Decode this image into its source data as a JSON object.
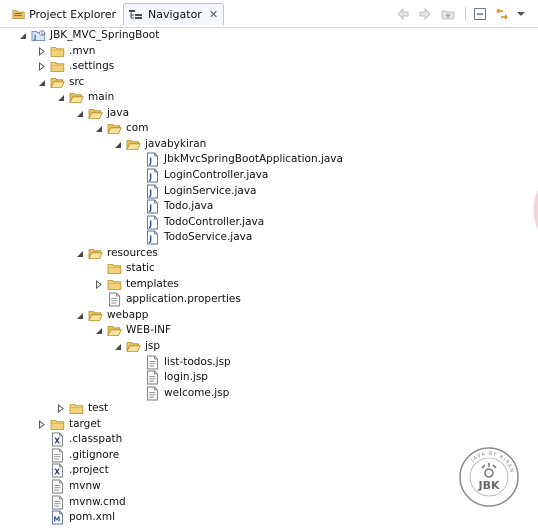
{
  "tabs": {
    "project_explorer": "Project Explorer",
    "navigator": "Navigator"
  },
  "tree": [
    {
      "name": "project-jbk-mvc-springboot",
      "label": "JBK_MVC_SpringBoot",
      "icon": "project",
      "depth": 0,
      "arrow": "expanded"
    },
    {
      "name": "folder-mvn",
      "label": ".mvn",
      "icon": "folder",
      "depth": 1,
      "arrow": "collapsed"
    },
    {
      "name": "folder-settings",
      "label": ".settings",
      "icon": "folder",
      "depth": 1,
      "arrow": "collapsed"
    },
    {
      "name": "folder-src",
      "label": "src",
      "icon": "folder-open",
      "depth": 1,
      "arrow": "expanded"
    },
    {
      "name": "folder-main",
      "label": "main",
      "icon": "folder-open",
      "depth": 2,
      "arrow": "expanded"
    },
    {
      "name": "folder-java",
      "label": "java",
      "icon": "folder-open",
      "depth": 3,
      "arrow": "expanded"
    },
    {
      "name": "folder-com",
      "label": "com",
      "icon": "folder-open",
      "depth": 4,
      "arrow": "expanded"
    },
    {
      "name": "folder-javabykiran",
      "label": "javabykiran",
      "icon": "folder-open",
      "depth": 5,
      "arrow": "expanded"
    },
    {
      "name": "file-jbkmvcspringbootapplication",
      "label": "JbkMvcSpringBootApplication.java",
      "icon": "java",
      "depth": 6,
      "arrow": "none"
    },
    {
      "name": "file-logincontroller",
      "label": "LoginController.java",
      "icon": "java",
      "depth": 6,
      "arrow": "none"
    },
    {
      "name": "file-loginservice",
      "label": "LoginService.java",
      "icon": "java",
      "depth": 6,
      "arrow": "none"
    },
    {
      "name": "file-todo",
      "label": "Todo.java",
      "icon": "java",
      "depth": 6,
      "arrow": "none"
    },
    {
      "name": "file-todocontroller",
      "label": "TodoController.java",
      "icon": "java",
      "depth": 6,
      "arrow": "none"
    },
    {
      "name": "file-todoservice",
      "label": "TodoService.java",
      "icon": "java",
      "depth": 6,
      "arrow": "none"
    },
    {
      "name": "folder-resources",
      "label": "resources",
      "icon": "folder-open",
      "depth": 3,
      "arrow": "expanded"
    },
    {
      "name": "folder-static",
      "label": "static",
      "icon": "folder",
      "depth": 4,
      "arrow": "none"
    },
    {
      "name": "folder-templates",
      "label": "templates",
      "icon": "folder",
      "depth": 4,
      "arrow": "collapsed"
    },
    {
      "name": "file-application-properties",
      "label": "application.properties",
      "icon": "text",
      "depth": 4,
      "arrow": "none"
    },
    {
      "name": "folder-webapp",
      "label": "webapp",
      "icon": "folder-open",
      "depth": 3,
      "arrow": "expanded"
    },
    {
      "name": "folder-web-inf",
      "label": "WEB-INF",
      "icon": "folder-open",
      "depth": 4,
      "arrow": "expanded"
    },
    {
      "name": "folder-jsp",
      "label": "jsp",
      "icon": "folder-open",
      "depth": 5,
      "arrow": "expanded"
    },
    {
      "name": "file-list-todos-jsp",
      "label": "list-todos.jsp",
      "icon": "text",
      "depth": 6,
      "arrow": "none"
    },
    {
      "name": "file-login-jsp",
      "label": "login.jsp",
      "icon": "text",
      "depth": 6,
      "arrow": "none"
    },
    {
      "name": "file-welcome-jsp",
      "label": "welcome.jsp",
      "icon": "text",
      "depth": 6,
      "arrow": "none"
    },
    {
      "name": "folder-test",
      "label": "test",
      "icon": "folder",
      "depth": 2,
      "arrow": "collapsed"
    },
    {
      "name": "folder-target",
      "label": "target",
      "icon": "folder",
      "depth": 1,
      "arrow": "collapsed"
    },
    {
      "name": "file-classpath",
      "label": ".classpath",
      "icon": "xml",
      "depth": 1,
      "arrow": "none"
    },
    {
      "name": "file-gitignore",
      "label": ".gitignore",
      "icon": "text",
      "depth": 1,
      "arrow": "none"
    },
    {
      "name": "file-project",
      "label": ".project",
      "icon": "xml",
      "depth": 1,
      "arrow": "none"
    },
    {
      "name": "file-mvnw",
      "label": "mvnw",
      "icon": "text",
      "depth": 1,
      "arrow": "none"
    },
    {
      "name": "file-mvnw-cmd",
      "label": "mvnw.cmd",
      "icon": "text",
      "depth": 1,
      "arrow": "none"
    },
    {
      "name": "file-pom-xml",
      "label": "pom.xml",
      "icon": "maven",
      "depth": 1,
      "arrow": "none"
    }
  ],
  "watermark": {
    "ring_text": "JAVA BY KIRAN",
    "label": "JBK"
  }
}
